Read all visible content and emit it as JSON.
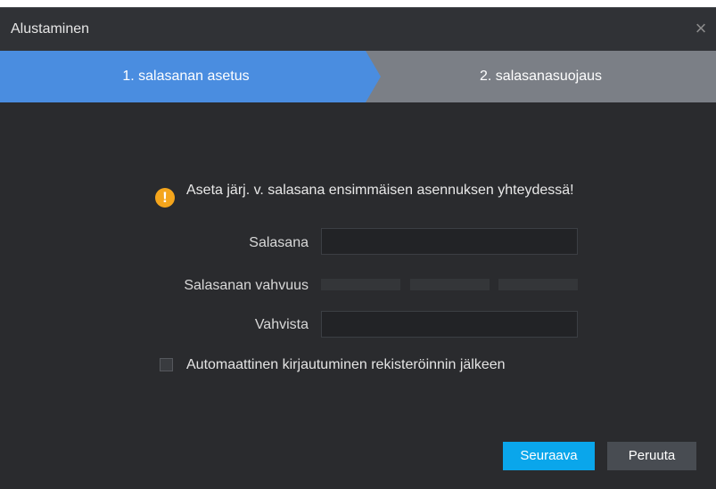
{
  "dialog": {
    "title": "Alustaminen",
    "close_icon": "close-icon"
  },
  "steps": [
    {
      "label": "1. salasanan asetus",
      "state": "active",
      "color": "#4a8de0"
    },
    {
      "label": "2. salasanasuojaus",
      "state": "inactive",
      "color": "#7b7f86"
    }
  ],
  "warning": {
    "icon": "warning-icon",
    "glyph": "!",
    "text": "Aseta järj. v. salasana ensimmäisen asennuksen yhteydessä!"
  },
  "form": {
    "password_label": "Salasana",
    "password_value": "",
    "strength_label": "Salasanan vahvuus",
    "strength_segments": 3,
    "confirm_label": "Vahvista",
    "confirm_value": ""
  },
  "auto_login": {
    "label": "Automaattinen kirjautuminen rekisteröinnin jälkeen",
    "checked": false
  },
  "buttons": {
    "next": "Seuraava",
    "cancel": "Peruuta"
  },
  "colors": {
    "background": "#2a2b2e",
    "title_bar": "#303236",
    "primary_button": "#0aa6eb",
    "secondary_button": "#484c52",
    "warning": "#f4a51c"
  }
}
